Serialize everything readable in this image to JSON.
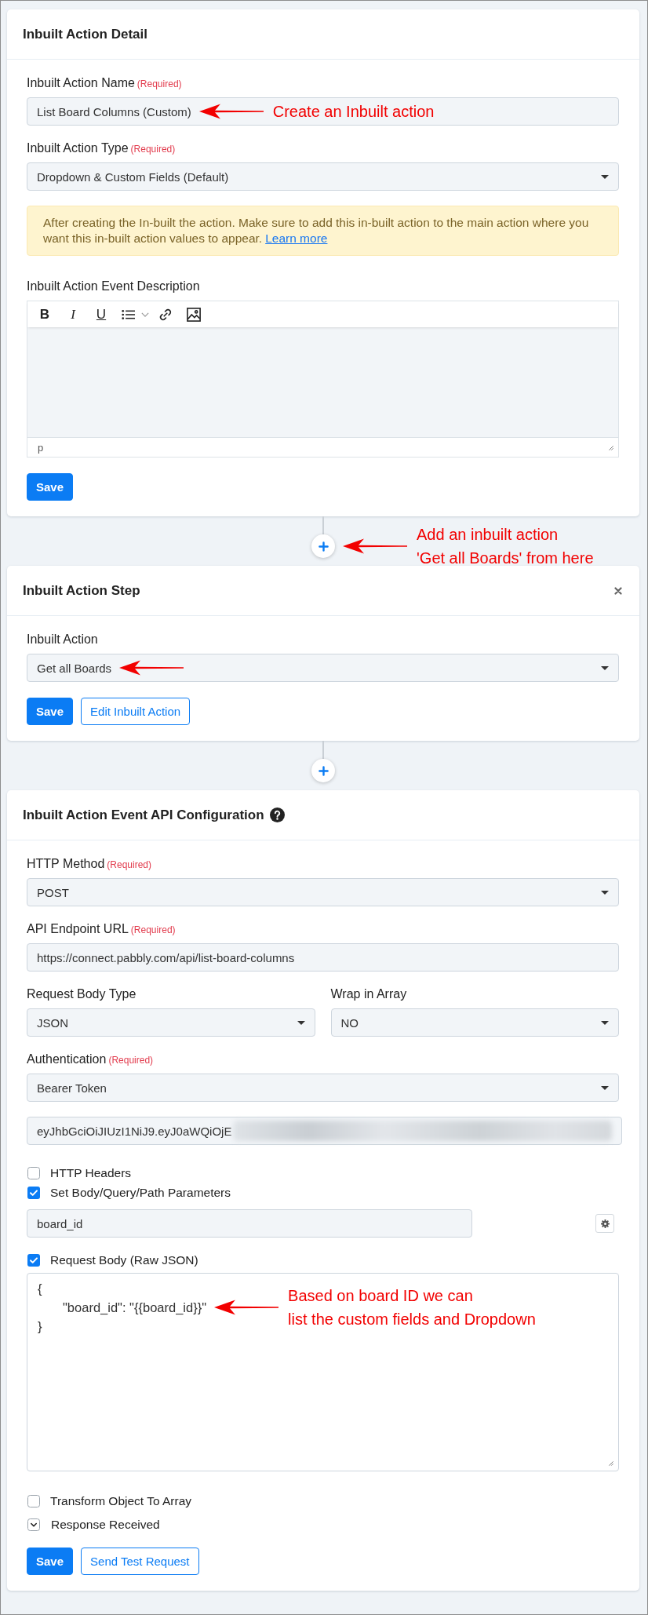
{
  "flow": [
    {
      "kind": "card",
      "title": "Inbuilt Action Detail",
      "items": [
        {
          "kind": "input",
          "label": "Inbuilt Action Name",
          "required": "(Required)",
          "value": "List Board Columns (Custom)",
          "annotation": {
            "arrow": true,
            "lines": [
              "Create an Inbuilt action"
            ]
          }
        },
        {
          "kind": "select",
          "label": "Inbuilt Action Type",
          "required": "(Required)",
          "value": "Dropdown & Custom Fields (Default)"
        },
        {
          "kind": "alert",
          "text": "After creating the In-built the action. Make sure to add this in-built action to the main action where you want this in-built action values to appear.",
          "link": "Learn more"
        },
        {
          "kind": "editor",
          "label": "Inbuilt Action Event Description",
          "toolbar": [
            {
              "kind": "bold",
              "label": "B"
            },
            {
              "kind": "italic",
              "label": "I"
            },
            {
              "kind": "underline",
              "label": "U"
            },
            {
              "kind": "list"
            },
            {
              "kind": "link"
            },
            {
              "kind": "image"
            }
          ],
          "status": "p"
        },
        {
          "kind": "buttons",
          "buttons": [
            {
              "label": "Save",
              "primary": true
            }
          ]
        }
      ]
    },
    {
      "kind": "add_step",
      "annotation": {
        "arrow": true,
        "lines": [
          "Add an inbuilt action",
          "'Get all Boards' from here"
        ]
      }
    },
    {
      "kind": "card",
      "title": "Inbuilt Action Step",
      "closable": true,
      "items": [
        {
          "kind": "select",
          "label": "Inbuilt Action",
          "value": "Get all Boards",
          "annotation": {
            "arrow": true
          }
        },
        {
          "kind": "buttons",
          "buttons": [
            {
              "label": "Save",
              "primary": true
            },
            {
              "label": "Edit Inbuilt Action",
              "primary": false
            }
          ]
        }
      ]
    },
    {
      "kind": "add_step"
    },
    {
      "kind": "card",
      "title": "Inbuilt Action Event API Configuration",
      "help": true,
      "items": [
        {
          "kind": "select",
          "label": "HTTP Method",
          "required": "(Required)",
          "value": "POST"
        },
        {
          "kind": "input",
          "label": "API Endpoint URL",
          "required": "(Required)",
          "value": "https://connect.pabbly.com/api/list-board-columns"
        },
        {
          "kind": "row",
          "items": [
            {
              "kind": "select",
              "label": "Request Body Type",
              "value": "JSON"
            },
            {
              "kind": "select",
              "label": "Wrap in Array",
              "value": "NO"
            }
          ]
        },
        {
          "kind": "select",
          "label": "Authentication",
          "required": "(Required)",
          "value": "Bearer Token"
        },
        {
          "kind": "input",
          "value": "eyJhbGciOiJIUzI1NiJ9.eyJ0aWQiOjE",
          "redacted": true
        },
        {
          "kind": "checkbox",
          "label": "HTTP Headers",
          "checked": false
        },
        {
          "kind": "checkbox",
          "label": "Set Body/Query/Path Parameters",
          "checked": true
        },
        {
          "kind": "param",
          "value": "board_id"
        },
        {
          "kind": "checkbox",
          "label": "Request Body (Raw JSON)",
          "checked": true
        },
        {
          "kind": "code",
          "open": "{",
          "body": [
            {
              "text": "\"board_id\": \"{{board_id}}\"",
              "annotation": {
                "arrow": true,
                "lines": [
                  "Based on board ID we can",
                  "list the custom fields and Dropdown"
                ]
              }
            }
          ],
          "close": "}"
        },
        {
          "kind": "checkbox",
          "label": "Transform Object To Array",
          "checked": false
        },
        {
          "kind": "toggle",
          "label": "Response Received",
          "expanded": false
        },
        {
          "kind": "buttons",
          "buttons": [
            {
              "label": "Save",
              "primary": true
            },
            {
              "label": "Send Test Request",
              "primary": false
            }
          ]
        }
      ]
    }
  ]
}
